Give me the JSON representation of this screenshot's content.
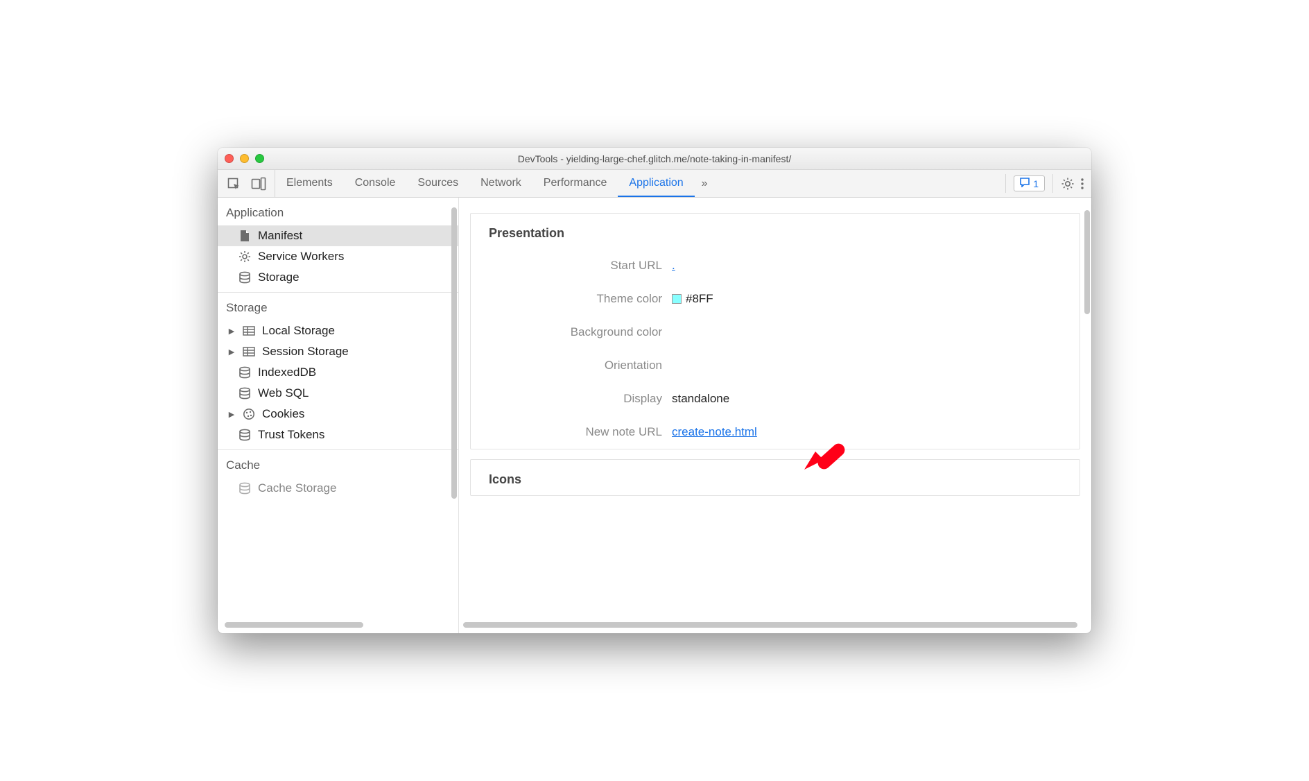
{
  "titlebar": {
    "title": "DevTools - yielding-large-chef.glitch.me/note-taking-in-manifest/"
  },
  "toolbar": {
    "tabs": [
      {
        "label": "Elements"
      },
      {
        "label": "Console"
      },
      {
        "label": "Sources"
      },
      {
        "label": "Network"
      },
      {
        "label": "Performance"
      },
      {
        "label": "Application"
      }
    ],
    "more": "»",
    "issues_count": "1"
  },
  "sidebar": {
    "sections": {
      "application": {
        "title": "Application",
        "items": [
          {
            "label": "Manifest"
          },
          {
            "label": "Service Workers"
          },
          {
            "label": "Storage"
          }
        ]
      },
      "storage": {
        "title": "Storage",
        "items": [
          {
            "label": "Local Storage"
          },
          {
            "label": "Session Storage"
          },
          {
            "label": "IndexedDB"
          },
          {
            "label": "Web SQL"
          },
          {
            "label": "Cookies"
          },
          {
            "label": "Trust Tokens"
          }
        ]
      },
      "cache": {
        "title": "Cache",
        "items": [
          {
            "label": "Cache Storage"
          }
        ]
      }
    }
  },
  "content": {
    "presentation": {
      "heading": "Presentation",
      "rows": {
        "start_url": {
          "label": "Start URL",
          "value": "."
        },
        "theme_color": {
          "label": "Theme color",
          "value": "#8FF",
          "swatch": "#88ffff"
        },
        "background_color": {
          "label": "Background color",
          "value": ""
        },
        "orientation": {
          "label": "Orientation",
          "value": ""
        },
        "display": {
          "label": "Display",
          "value": "standalone"
        },
        "new_note_url": {
          "label": "New note URL",
          "value": "create-note.html"
        }
      }
    },
    "icons": {
      "heading": "Icons"
    }
  }
}
